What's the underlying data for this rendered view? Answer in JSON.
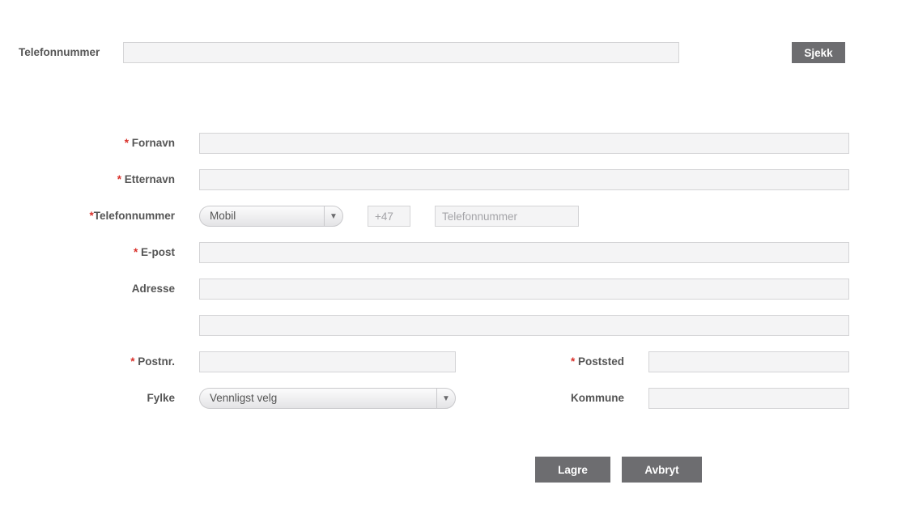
{
  "top": {
    "phone_label": "Telefonnummer",
    "phone_value": "",
    "check_button": "Sjekk"
  },
  "form": {
    "required_marker": "*",
    "first_name_label": "Fornavn",
    "last_name_label": "Etternavn",
    "phone_label": "Telefonnummer",
    "phone_type_selected": "Mobil",
    "country_code": "+47",
    "phone_placeholder": "Telefonnummer",
    "email_label": "E-post",
    "address_label": "Adresse",
    "zip_label": "Postnr.",
    "city_label": "Poststed",
    "county_label": "Fylke",
    "county_selected": "Vennligst velg",
    "municipality_label": "Kommune"
  },
  "actions": {
    "save_label": "Lagre",
    "cancel_label": "Avbryt"
  },
  "colors": {
    "required": "#d9302a",
    "button_bg": "#6d6d70",
    "input_bg": "#f4f4f5"
  },
  "icons": {
    "dropdown": "chevron-down-icon"
  }
}
